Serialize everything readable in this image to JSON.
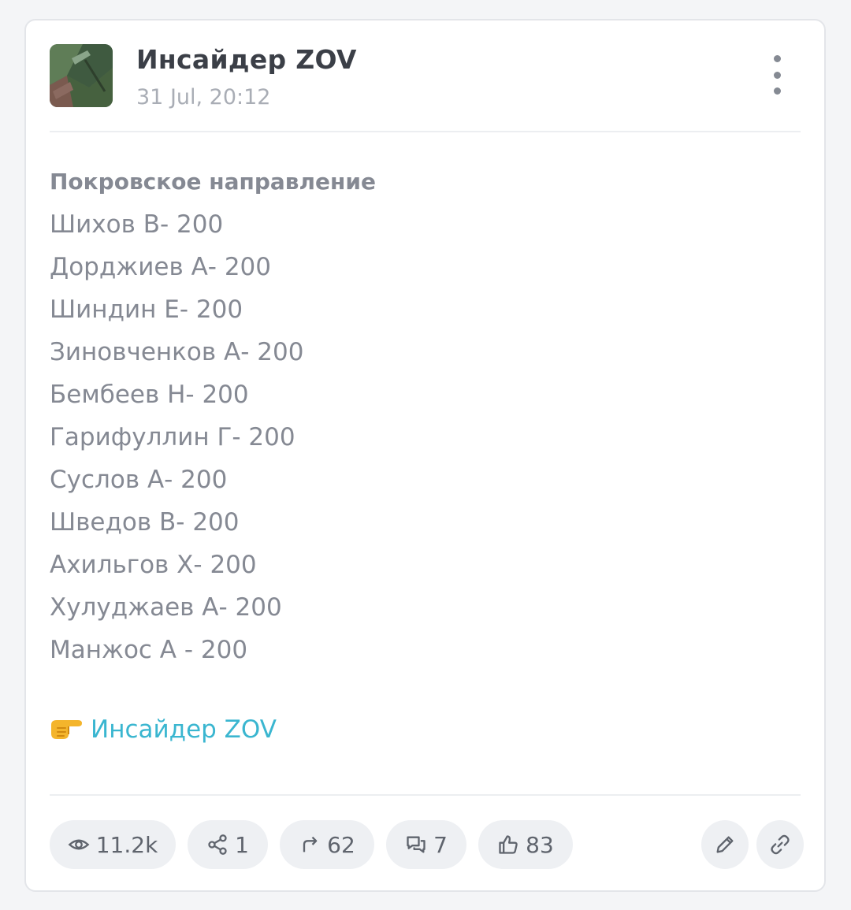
{
  "channel": {
    "name": "Инсайдер ZOV",
    "time": "31 Jul, 20:12"
  },
  "post": {
    "heading": "Покровское направление",
    "lines": [
      "Шихов В- 200",
      "Дорджиев А- 200",
      "Шиндин Е- 200",
      "Зиновченков А- 200",
      "Бембеев Н- 200",
      "Гарифуллин Г- 200",
      "Суслов А- 200",
      "Шведов В- 200",
      "Ахильгов Х- 200",
      "Хулуджаев А- 200",
      "Манжос А - 200"
    ],
    "source_link": "Инсайдер ZOV"
  },
  "stats": {
    "views": "11.2k",
    "shares": "1",
    "forwards": "62",
    "comments": "7",
    "likes": "83"
  },
  "icons": {
    "views": "eye-icon",
    "shares": "share-nodes-icon",
    "forwards": "forward-arrow-icon",
    "comments": "comments-icon",
    "likes": "thumbs-up-icon",
    "edit": "pencil-icon",
    "link": "link-icon",
    "menu": "more-vertical-icon",
    "pointer": "pointing-hand-emoji"
  },
  "colors": {
    "link": "#3ab6d0",
    "text": "#858993",
    "title": "#3b3f47",
    "pill_bg": "#eef0f3"
  }
}
